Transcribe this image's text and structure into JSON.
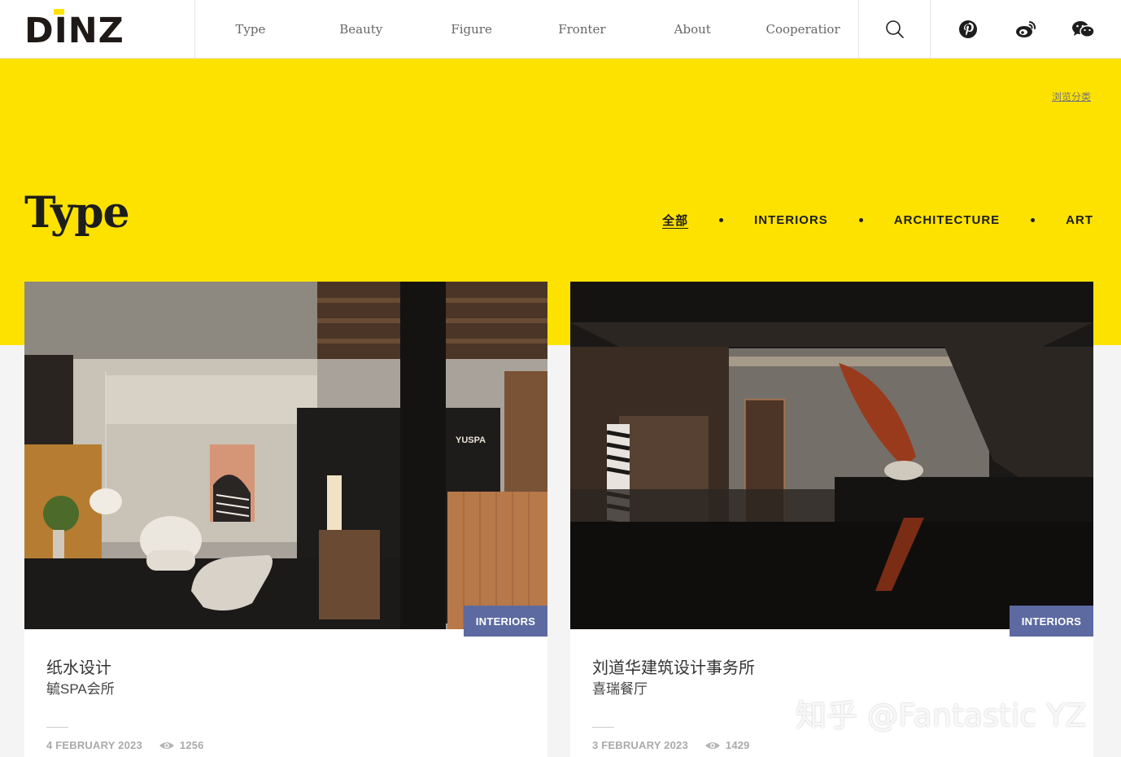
{
  "brand": {
    "logo_text": "DINZ",
    "accent": "#fde200"
  },
  "nav": {
    "items": [
      {
        "label": "Type"
      },
      {
        "label": "Beauty"
      },
      {
        "label": "Figure"
      },
      {
        "label": "Fronter"
      },
      {
        "label": "About"
      },
      {
        "label": "Cooperatior"
      }
    ],
    "search_icon": "search-icon",
    "social": [
      "pinterest-icon",
      "weibo-icon",
      "wechat-icon"
    ]
  },
  "hero": {
    "browse_label": "浏览分类",
    "title": "Type",
    "background": "#fde200",
    "filters": [
      {
        "label": "全部",
        "active": true
      },
      {
        "label": "INTERIORS",
        "active": false
      },
      {
        "label": "ARCHITECTURE",
        "active": false
      },
      {
        "label": "ART",
        "active": false
      }
    ]
  },
  "cards": [
    {
      "tag": "INTERIORS",
      "title": "纸水设计",
      "subtitle": "毓SPA会所",
      "date": "4 FEBRUARY 2023",
      "views": "1256",
      "photo_brand_text": "YUSPA"
    },
    {
      "tag": "INTERIORS",
      "title": "刘道华建筑设计事务所",
      "subtitle": "喜瑞餐厅",
      "date": "3 FEBRUARY 2023",
      "views": "1429"
    }
  ],
  "watermark": "知乎 @Fantastic YZ",
  "colors": {
    "tag_bg": "#5d6aa1",
    "meta_text": "#aaaaaa"
  }
}
